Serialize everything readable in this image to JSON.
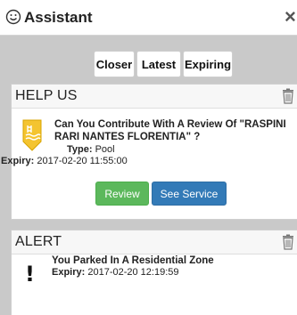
{
  "header": {
    "title": "Assistant",
    "close_glyph": "×",
    "icon": "smiley-icon"
  },
  "filters": [
    "Closer",
    "Latest",
    "Expiring"
  ],
  "help_card": {
    "title": "HELP US",
    "question": "Can You Contribute With A Review Of \"RASPINI RARI NANTES FLORENTIA\" ?",
    "type_label": "Type:",
    "type_value": "Pool",
    "expiry_label": "Expiry:",
    "expiry_value": "2017-02-20 11:55:00",
    "review_label": "Review",
    "service_label": "See Service",
    "icon": "pool-icon"
  },
  "alert_card": {
    "title": "ALERT",
    "message": "You Parked In A Residential Zone",
    "expiry_label": "Expiry:",
    "expiry_value": "2017-02-20 12:19:59",
    "icon_glyph": "!"
  },
  "colors": {
    "review": "#5cb85c",
    "service": "#337ab7",
    "pool_icon": "#f4c430"
  }
}
